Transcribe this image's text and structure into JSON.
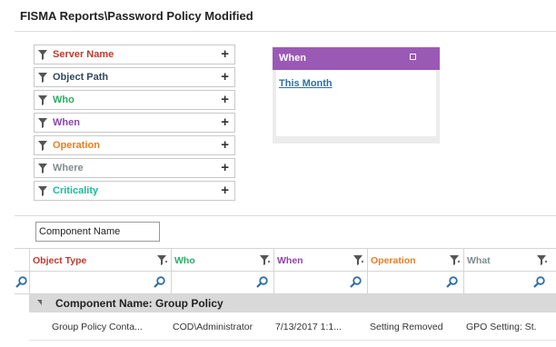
{
  "page": {
    "title": "FISMA Reports\\Password Policy Modified"
  },
  "filters": [
    {
      "label": "Server Name",
      "color": "#c0392b"
    },
    {
      "label": "Object Path",
      "color": "#34495e"
    },
    {
      "label": "Who",
      "color": "#27ae60"
    },
    {
      "label": "When",
      "color": "#8e44ad"
    },
    {
      "label": "Operation",
      "color": "#e67e22"
    },
    {
      "label": "Where",
      "color": "#7f8c8d"
    },
    {
      "label": "Criticality",
      "color": "#1abc9c"
    }
  ],
  "when_panel": {
    "title": "When",
    "header_color": "#9b59b6",
    "link": "This Month"
  },
  "grouping": {
    "label": "Component Name"
  },
  "grid": {
    "columns": [
      {
        "label": "Object Type",
        "color": "#c0392b"
      },
      {
        "label": "Who",
        "color": "#27ae60"
      },
      {
        "label": "When",
        "color": "#8e44ad"
      },
      {
        "label": "Operation",
        "color": "#e67e22"
      },
      {
        "label": "What",
        "color": "#7f8c8d"
      }
    ],
    "group_row": "Component Name: Group Policy",
    "rows": [
      {
        "object_type": "Group Policy Conta...",
        "who": "COD\\Administrator",
        "when": "7/13/2017 1:1...",
        "operation": "Setting Removed",
        "what": "GPO Setting: St."
      }
    ]
  },
  "colors": {
    "search_icon": "#2f6fa7",
    "funnel_icon": "#555555"
  }
}
